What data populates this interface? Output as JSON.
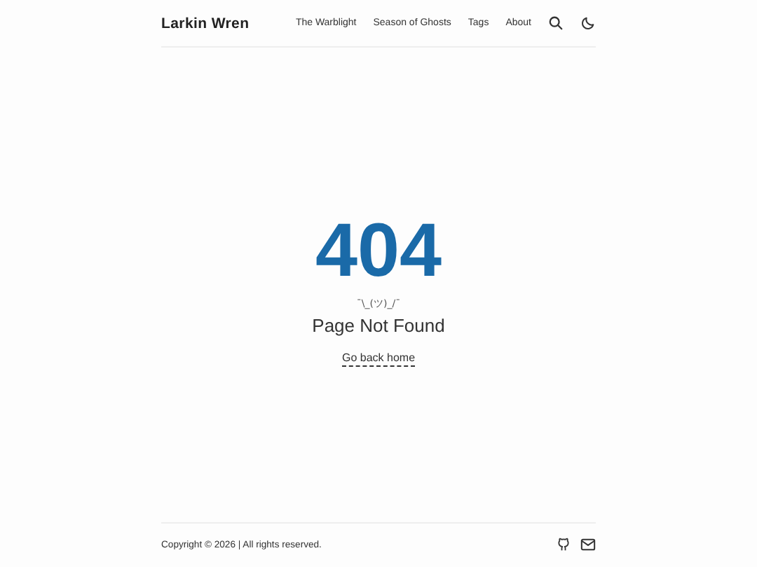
{
  "site_title": "Larkin Wren",
  "nav": [
    {
      "label": "The Warblight"
    },
    {
      "label": "Season of Ghosts"
    },
    {
      "label": "Tags"
    },
    {
      "label": "About"
    }
  ],
  "error": {
    "code": "404",
    "shrug": "¯\\_(ツ)_/¯",
    "message": "Page Not Found",
    "link": "Go back home"
  },
  "footer": {
    "copyright": "Copyright © 2026 | All rights reserved."
  }
}
